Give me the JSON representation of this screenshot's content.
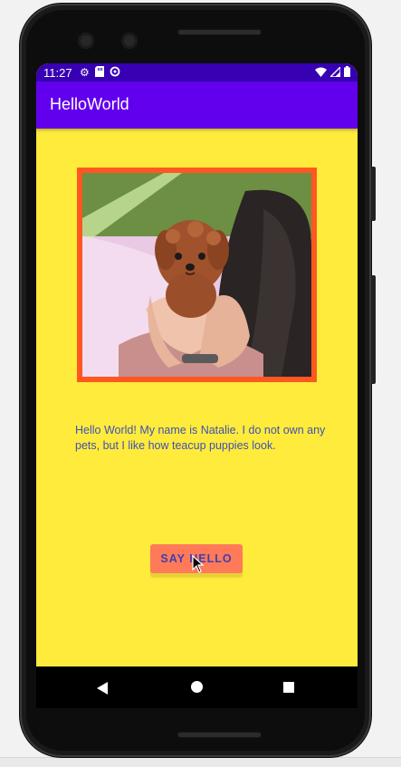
{
  "status_bar": {
    "time": "11:27",
    "left_icons": [
      "gear-icon",
      "sd-card-icon",
      "sync-icon"
    ],
    "right_icons": [
      "wifi-icon",
      "cell-signal-icon",
      "battery-icon"
    ]
  },
  "app_bar": {
    "title": "HelloWorld",
    "color": "#6200ee",
    "status_color": "#3700b3"
  },
  "content": {
    "background": "#ffeb3b",
    "image": {
      "subject": "teacup-puppy-photo",
      "frame_color": "#ff5722"
    },
    "intro_text": "Hello World! My name is Natalie. I do not own any pets, but I like how teacup puppies look.",
    "button_label": "SAY HELLO",
    "button_color": "#ff7a59"
  },
  "nav_bar": {
    "icons": [
      "back-icon",
      "home-icon",
      "recents-icon"
    ]
  }
}
